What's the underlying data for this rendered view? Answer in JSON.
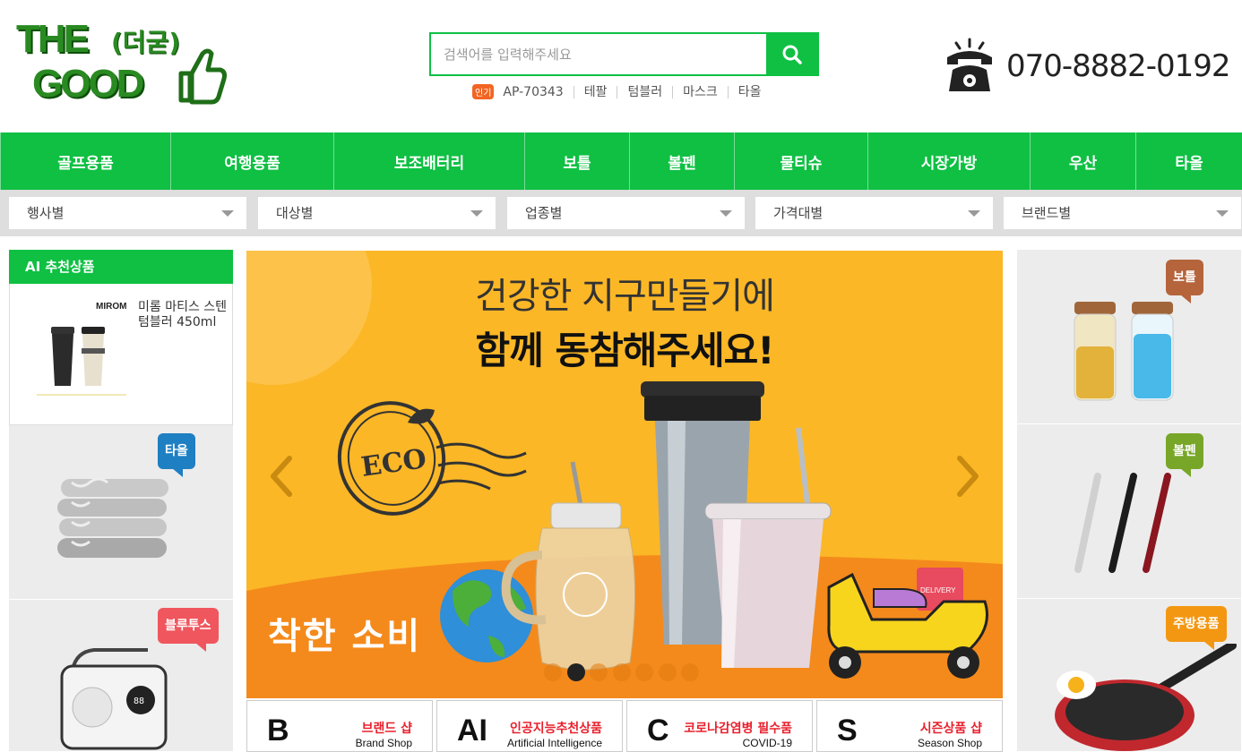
{
  "logo": {
    "line1": "THE",
    "sub": "(더굳)",
    "line2": "GOOD"
  },
  "search": {
    "placeholder": "검색어를 입력해주세요"
  },
  "popular": {
    "badge": "인기",
    "keywords": [
      "AP-70343",
      "테팔",
      "텀블러",
      "마스크",
      "타올"
    ]
  },
  "phone": {
    "number": "070-8882-0192"
  },
  "gnb": [
    "골프용품",
    "여행용품",
    "보조배터리",
    "보틀",
    "볼펜",
    "물티슈",
    "시장가방",
    "우산",
    "타올"
  ],
  "filters": [
    "행사별",
    "대상별",
    "업종별",
    "가격대별",
    "브랜드별"
  ],
  "ai": {
    "title": "AI 추천상품",
    "brand": "MIROM",
    "product": "미롬 마티스 스텐텀블러 450ml"
  },
  "left_tiles": [
    {
      "tag": "타올",
      "color": "#1e7fc3"
    },
    {
      "tag": "블루투스",
      "color": "#f0565e"
    }
  ],
  "right_tiles": [
    {
      "tag": "보틀",
      "color": "#b5643c"
    },
    {
      "tag": "볼펜",
      "color": "#78a628"
    },
    {
      "tag": "주방용품",
      "color": "#f39712"
    }
  ],
  "banner": {
    "headline1": "건강한 지구만들기에",
    "headline2": "함께 동참해주세요!",
    "stamp": "ECO",
    "bottom_text": "착한 소비",
    "scooter_box": "DELIVERY",
    "slide_count": 7,
    "active_slide": 2
  },
  "shops": [
    {
      "letter": "B",
      "kr": "브랜드 샵",
      "en": "Brand Shop"
    },
    {
      "letter": "AI",
      "kr": "인공지능추천상품",
      "en": "Artificial Intelligence"
    },
    {
      "letter": "C",
      "kr": "코로나감염병 필수품",
      "en": "COVID-19"
    },
    {
      "letter": "S",
      "kr": "시즌상품 샵",
      "en": "Season Shop"
    }
  ],
  "colors": {
    "brand_green": "#0fc043",
    "banner_bg": "#fbb726",
    "accent_red": "#e8212e"
  }
}
